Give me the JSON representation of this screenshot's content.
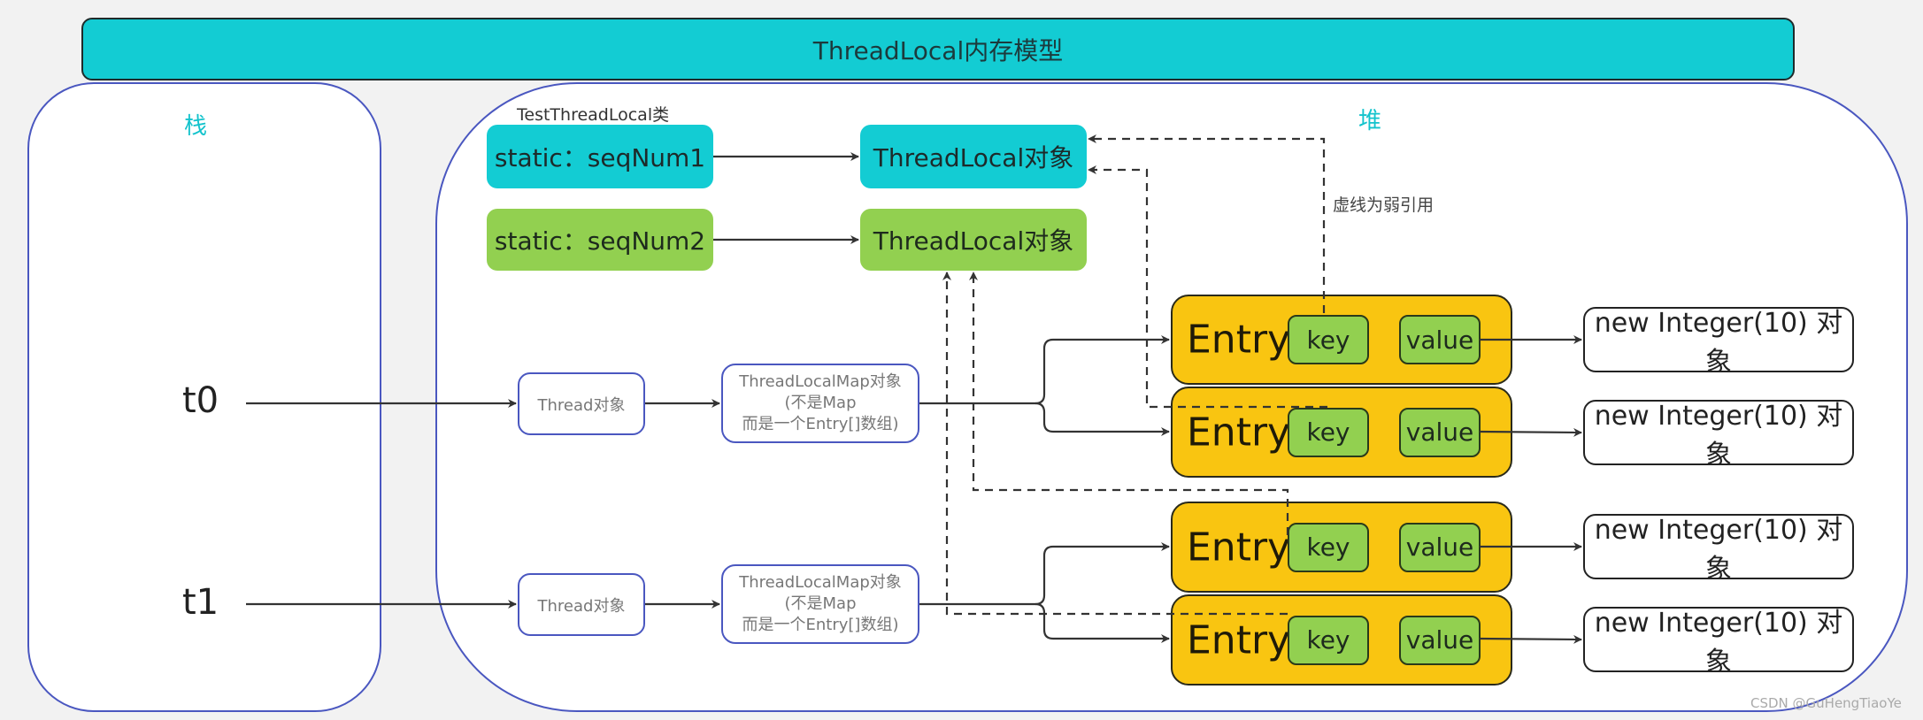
{
  "title": "ThreadLocal内存模型",
  "stack": {
    "label": "栈",
    "threads": [
      "t0",
      "t1"
    ]
  },
  "heap": {
    "label": "堆"
  },
  "class_label": "TestThreadLocal类",
  "statics": [
    {
      "label": "static：seqNum1",
      "target": "ThreadLocal对象",
      "color": "#13ccd3"
    },
    {
      "label": "static：seqNum2",
      "target": "ThreadLocal对象",
      "color": "#92d050"
    }
  ],
  "thread_objects": [
    "Thread对象",
    "Thread对象"
  ],
  "maps": [
    {
      "line1": "ThreadLocalMap对象",
      "line2": "(不是Map",
      "line3": "而是一个Entry[]数组)"
    },
    {
      "line1": "ThreadLocalMap对象",
      "line2": "(不是Map",
      "line3": "而是一个Entry[]数组)"
    }
  ],
  "entries": [
    {
      "label": "Entry",
      "key": "key",
      "value": "value",
      "value_target": "new Integer(10) 对象"
    },
    {
      "label": "Entry",
      "key": "key",
      "value": "value",
      "value_target": "new Integer(10) 对象"
    },
    {
      "label": "Entry",
      "key": "key",
      "value": "value",
      "value_target": "new Integer(10) 对象"
    },
    {
      "label": "Entry",
      "key": "key",
      "value": "value",
      "value_target": "new Integer(10) 对象"
    }
  ],
  "weak_ref_note": "虚线为弱引用",
  "watermark": "CSDN @GuHengTiaoYe",
  "colors": {
    "cyan": "#13ccd3",
    "green": "#92d050",
    "yellow": "#f9c511",
    "region_border": "#4a57c0"
  }
}
